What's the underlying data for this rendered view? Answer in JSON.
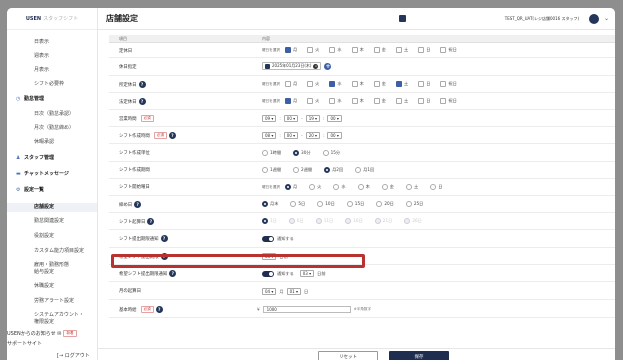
{
  "app": {
    "logo_main": "USEN",
    "logo_sub": "スタッフシフト"
  },
  "header": {
    "title": "店舗設定",
    "user": "TEST_QR_UAT(レジ店舗0016 スタッフ)"
  },
  "sidebar": {
    "items": [
      {
        "label": "日表示"
      },
      {
        "label": "週表示"
      },
      {
        "label": "月表示"
      },
      {
        "label": "シフト必要枠"
      },
      {
        "label": "勤怠管理"
      },
      {
        "label": "日次（勤怠承認）"
      },
      {
        "label": "月次（勤怠締め）"
      },
      {
        "label": "休暇承認"
      },
      {
        "label": "スタッフ管理"
      },
      {
        "label": "チャットメッセージ"
      },
      {
        "label": "設定一覧"
      },
      {
        "label": "店舗設定"
      },
      {
        "label": "勤怠関連設定"
      },
      {
        "label": "役割設定"
      },
      {
        "label": "カスタム能力項目設定"
      },
      {
        "label": "雇用・勤務形態"
      },
      {
        "label": "給与設定"
      },
      {
        "label": "休職設定"
      },
      {
        "label": "労務アラート設定"
      },
      {
        "label": "システムアカウント・"
      },
      {
        "label": "権限設定"
      }
    ],
    "notice": "USENからのお知らせ",
    "notice_badge": "新着",
    "support": "サポートサイト",
    "logout": "ログアウト"
  },
  "table": {
    "col_item": "項目",
    "col_content": "内容"
  },
  "weekdays": [
    "月",
    "火",
    "水",
    "木",
    "金",
    "土",
    "日",
    "祝日"
  ],
  "rows": {
    "r0": {
      "label": "定休日",
      "prefix": "曜日を選択",
      "checked": [
        true,
        false,
        false,
        false,
        false,
        false,
        false,
        false
      ]
    },
    "r1": {
      "label": "休日指定",
      "date": "2025年01月23日(木)"
    },
    "r2": {
      "label": "所定休日",
      "prefix": "曜日を選択",
      "checked": [
        false,
        false,
        true,
        false,
        false,
        true,
        false,
        false
      ]
    },
    "r3": {
      "label": "法定休日",
      "prefix": "曜日を選択",
      "checked": [
        true,
        false,
        false,
        false,
        false,
        false,
        false,
        false
      ]
    },
    "r4": {
      "label": "営業時間",
      "badge": "必須",
      "h1": "09",
      "m1": "00",
      "h2": "19",
      "m2": "00"
    },
    "r5": {
      "label": "シフト作成時間",
      "badge": "必須",
      "h1": "08",
      "m1": "00",
      "h2": "20",
      "m2": "00"
    },
    "r6": {
      "label": "シフト作成単位",
      "options": [
        "1時間",
        "30分",
        "15分"
      ],
      "selected": 1
    },
    "r7": {
      "label": "シフト作成期間",
      "options": [
        "1週間",
        "2週間",
        "月2回",
        "月1回"
      ],
      "selected": 2
    },
    "r8": {
      "label": "シフト開始曜日",
      "prefix": "曜日を選択",
      "options": [
        "月",
        "火",
        "水",
        "木",
        "金",
        "土",
        "日"
      ],
      "selected": 0
    },
    "r9": {
      "label": "締め日",
      "options": [
        "月末",
        "5日",
        "10日",
        "15日",
        "20日",
        "25日"
      ],
      "selected": 0
    },
    "r10": {
      "label": "シフト起算日",
      "options": [
        "1日",
        "6日",
        "11日",
        "16日",
        "21日",
        "26日"
      ],
      "selected": 0
    },
    "r11": {
      "label": "シフト提出期限通知",
      "toggle": "通知する"
    },
    "r12": {
      "label": "希望シフト提出期限",
      "value": "03",
      "unit": "日前"
    },
    "r13": {
      "label": "希望シフト提出期限通知",
      "toggle": "通知する",
      "value": "03",
      "unit": "日前"
    },
    "r14": {
      "label": "月の起算日",
      "month": "04",
      "month_unit": "月",
      "day": "01",
      "day_unit": "日"
    },
    "r15": {
      "label": "基本時給",
      "badge": "必須",
      "yen": "¥",
      "value": "1000",
      "hint": "※半角数字"
    }
  },
  "footer": {
    "reset": "リセット",
    "save": "保存"
  }
}
